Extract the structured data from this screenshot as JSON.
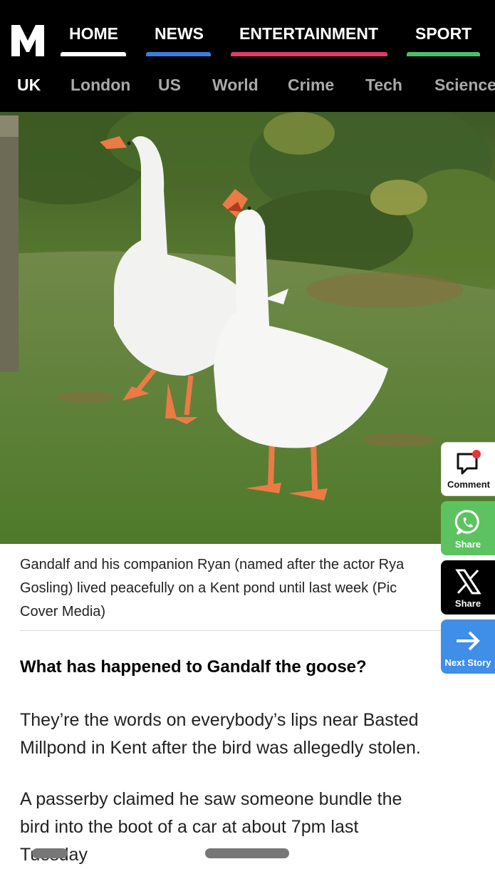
{
  "brand": {
    "logo_letter": "M"
  },
  "nav": {
    "main": [
      {
        "label": "HOME",
        "accent": "#ffffff"
      },
      {
        "label": "NEWS",
        "accent": "#3b7ddd"
      },
      {
        "label": "ENTERTAINMENT",
        "accent": "#e03a66"
      },
      {
        "label": "SPORT",
        "accent": "#4cbe6a"
      }
    ],
    "sub": [
      "UK",
      "London",
      "US",
      "World",
      "Crime",
      "Tech",
      "Science"
    ],
    "active_sub": "UK"
  },
  "article": {
    "image_alt": "Two white geese standing on grass",
    "caption_lines": [
      "Gandalf and his companion Ryan (named after the actor Rya",
      "Gosling) lived peacefully on a Kent pond until last week (Pic",
      "Cover Media)"
    ],
    "subheading": "What has happened to Gandalf the goose?",
    "para1_lines": [
      "They’re the words on everybody’s lips near Basted",
      "Millpond in Kent after the bird was allegedly stolen."
    ],
    "para2_lines": [
      "A passerby claimed he saw someone bundle the",
      "bird into the boot of a car at about 7pm last",
      "Tuesday"
    ]
  },
  "side_actions": {
    "comment": {
      "label": "Comment",
      "color": "#ffffff",
      "badge": "#e8323c"
    },
    "whatsapp": {
      "label": "Share",
      "color": "#5dc361"
    },
    "x": {
      "label": "Share",
      "color": "#000000"
    },
    "next": {
      "label": "Next Story",
      "color": "#3f8ee8"
    }
  }
}
